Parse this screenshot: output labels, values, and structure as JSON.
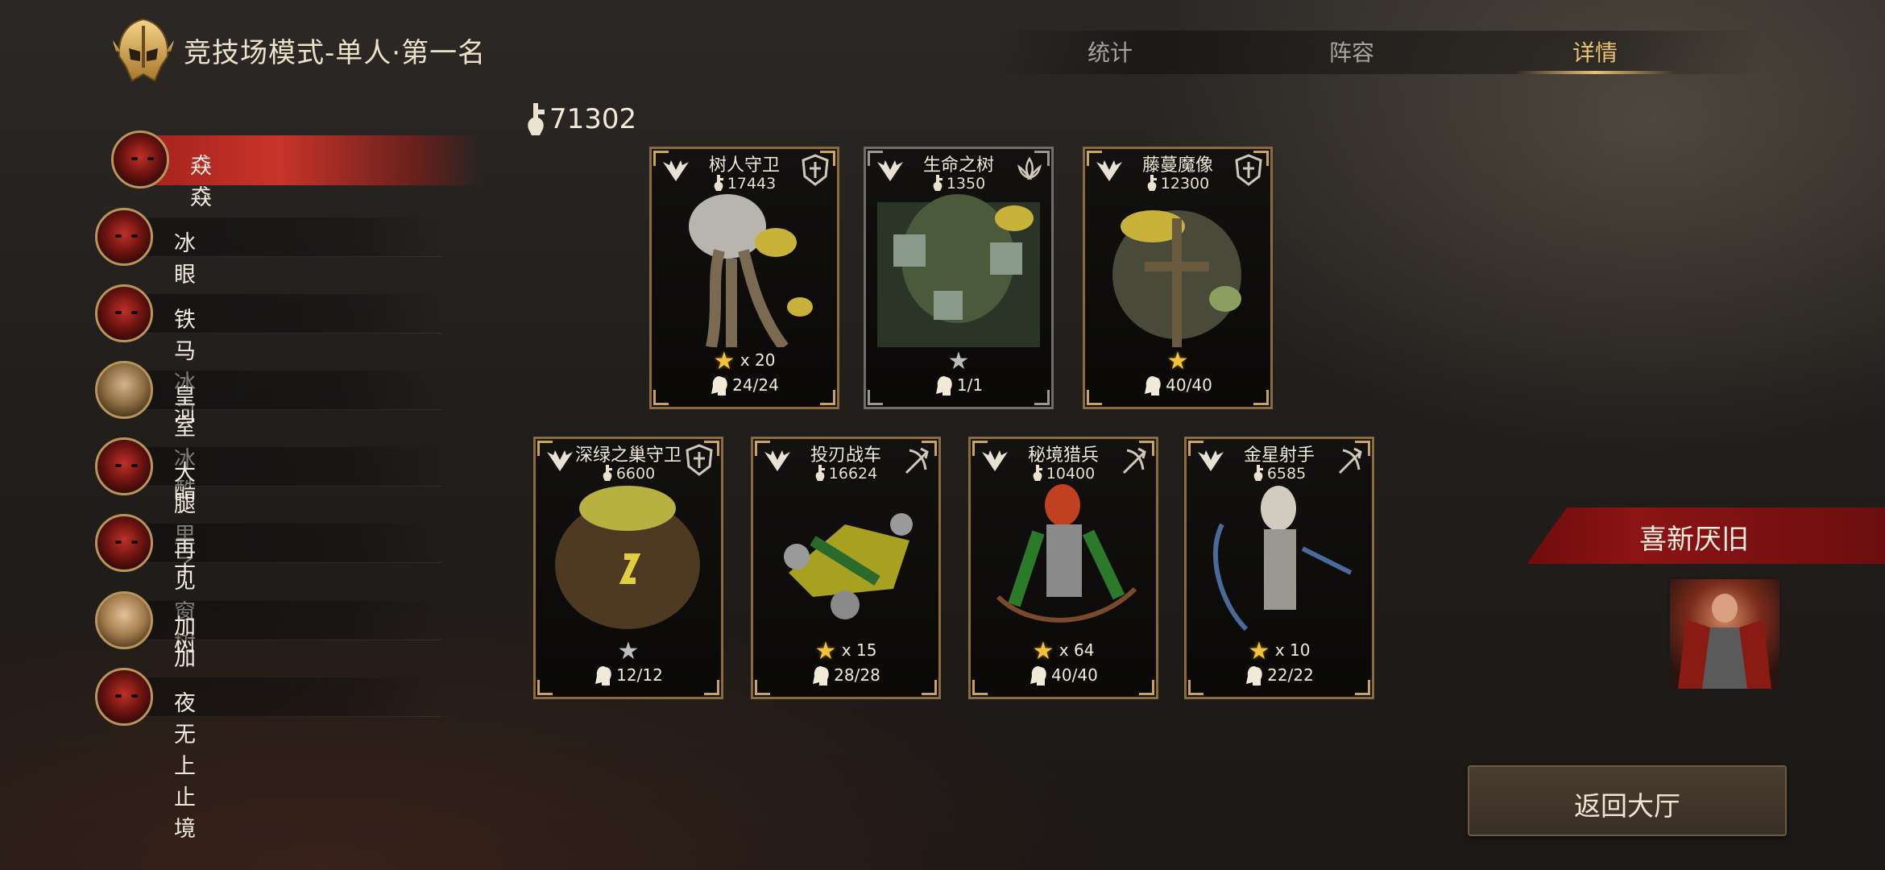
{
  "header": {
    "title": "竞技场模式-单人·第一名",
    "tabs": [
      {
        "label": "统计",
        "active": false
      },
      {
        "label": "阵容",
        "active": false
      },
      {
        "label": "详情",
        "active": true
      }
    ],
    "accent_color": "#e8c274"
  },
  "sidebar": {
    "players": [
      {
        "name": "猋猋",
        "avatar": "demon-mask",
        "active": true
      },
      {
        "name": "冰眼",
        "avatar": "demon-mask",
        "active": false
      },
      {
        "name": "铁马冰河",
        "avatar": "demon-mask",
        "active": false
      },
      {
        "name": "皇室冰酷",
        "avatar": "elf-hero",
        "active": false
      },
      {
        "name": "大腿里子",
        "avatar": "demon-mask",
        "active": false
      },
      {
        "name": "再见窗树",
        "avatar": "demon-mask",
        "active": false
      },
      {
        "name": "加加",
        "avatar": "female-hero",
        "active": false
      },
      {
        "name": "夜无上止境",
        "avatar": "demon-mask",
        "active": false
      }
    ]
  },
  "total_power": "71302",
  "cards": [
    {
      "name": "树人守卫",
      "power": "17443",
      "stars": "x 20",
      "star_color": "gold",
      "count": "24/24",
      "role": "shield-icon",
      "frame": "gold"
    },
    {
      "name": "生命之树",
      "power": "1350",
      "stars": "",
      "star_color": "grey",
      "count": "1/1",
      "role": "lotus-icon",
      "frame": "silver"
    },
    {
      "name": "藤蔓魔像",
      "power": "12300",
      "stars": "",
      "star_color": "gold",
      "count": "40/40",
      "role": "shield-icon",
      "frame": "gold"
    },
    {
      "name": "深绿之巢守卫",
      "power": "6600",
      "stars": "",
      "star_color": "grey",
      "count": "12/12",
      "role": "shield-icon",
      "frame": "gold"
    },
    {
      "name": "投刃战车",
      "power": "16624",
      "stars": "x 15",
      "star_color": "gold",
      "count": "28/28",
      "role": "bow-icon",
      "frame": "gold"
    },
    {
      "name": "秘境猎兵",
      "power": "10400",
      "stars": "x 64",
      "star_color": "gold",
      "count": "40/40",
      "role": "bow-icon",
      "frame": "gold"
    },
    {
      "name": "金星射手",
      "power": "6585",
      "stars": "x 10",
      "star_color": "gold",
      "count": "22/22",
      "role": "bow-icon",
      "frame": "gold"
    }
  ],
  "right_panel": {
    "banner_text": "喜新厌旧",
    "hero_portrait": "red-armored-hero",
    "back_button_label": "返回大厅"
  }
}
